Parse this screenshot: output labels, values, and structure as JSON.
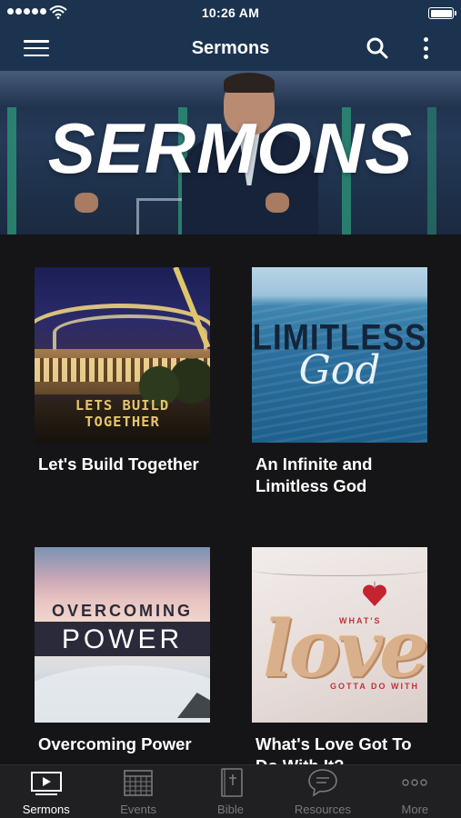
{
  "status_bar": {
    "time": "10:26 AM",
    "signal_icon": "signal-dots-icon",
    "wifi_icon": "wifi-icon",
    "battery_icon": "battery-icon"
  },
  "nav": {
    "title": "Sermons",
    "menu_icon": "hamburger-menu-icon",
    "search_icon": "search-icon",
    "more_icon": "vertical-ellipsis-icon"
  },
  "banner": {
    "title": "SERMONS"
  },
  "sermons": [
    {
      "title": "Let's Build Together",
      "artwork_text": "LETS BUILD TOGETHER"
    },
    {
      "title": "An Infinite and Limitless God",
      "artwork_text_1": "LIMITLESS",
      "artwork_text_2": "God"
    },
    {
      "title": "Overcoming Power",
      "artwork_text_1": "OVERCOMING",
      "artwork_text_2": "POWER"
    },
    {
      "title": "What's Love Got To Do With It?",
      "artwork_text_1": "WHAT'S",
      "artwork_text_2": "love",
      "artwork_text_3": "GOTTA DO WITH"
    }
  ],
  "tabs": [
    {
      "label": "Sermons",
      "icon": "video-player-icon",
      "active": true
    },
    {
      "label": "Events",
      "icon": "calendar-icon",
      "active": false
    },
    {
      "label": "Bible",
      "icon": "bible-icon",
      "active": false
    },
    {
      "label": "Resources",
      "icon": "chat-bubble-icon",
      "active": false
    },
    {
      "label": "More",
      "icon": "horizontal-ellipsis-icon",
      "active": false
    }
  ],
  "colors": {
    "nav_background": "#1c3350",
    "page_background": "#151517",
    "tab_bar_background": "#202022",
    "tab_active": "#ffffff",
    "tab_inactive": "#7a7a7e"
  }
}
